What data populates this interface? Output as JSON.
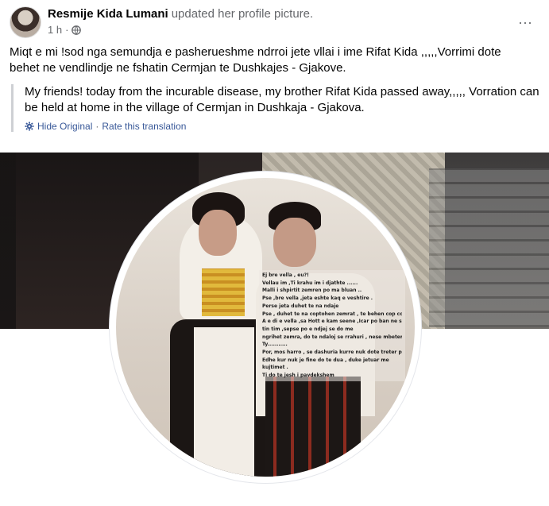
{
  "post": {
    "author": "Resmije Kida Lumani",
    "action": "updated her profile picture.",
    "time": "1 h",
    "dot": "·",
    "original_text": "Miqt e mi !sod nga semundja e pasherueshme ndrroi jete vllai i ime Rifat Kida ,,,,,Vorrimi dote behet ne vendlindje ne fshatin Cermjan te Dushkajes - Gjakove.",
    "translation_text": "My friends! today from the incurable disease, my brother Rifat Kida passed away,,,,, Vorration can be held at home in the village of Cermjan in Dushkaja - Gjakova.",
    "hide_original_label": "Hide Original",
    "separator": "·",
    "rate_translation_label": "Rate this translation",
    "more_label": "···"
  },
  "photo_poem": [
    "Ej bre vella , eu?!",
    "Vellau im ,Ti krahu im i djathte ......",
    "Malli i shpirtit zemren po ma bluan ..",
    "Pse ,bre vella ,jeta eshte kaq e veshtire .",
    "Perse jeta duhet te na ndaje",
    "Pse , duhet te na coptohen zemrat , te behen cop cop.",
    "A e di e vella ,sa  Hott e kam seene ,Icar po ban ne shpir-",
    "tin tim ,sepse po e ndjej se do me",
    "ngrihet zemra, do te ndaloj se rrahuri , nese mbetem pa",
    "Ty...........",
    "Por, mos harro , se dashuria kurre nuk dote treter per Ty.",
    "Edhe kur nuk je fine do te dua , duke jetuar me",
    "kujtimet .",
    "Ti do te jesh i pavdekshem"
  ]
}
